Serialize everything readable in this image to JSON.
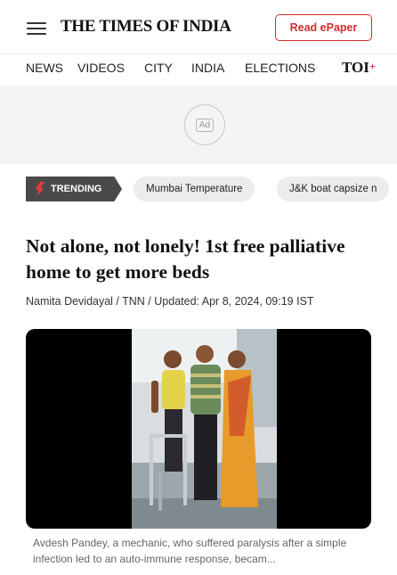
{
  "header": {
    "brand": "THE TIMES OF INDIA",
    "epaper_label": "Read ePaper"
  },
  "nav": {
    "items": [
      "NEWS",
      "VIDEOS",
      "CITY",
      "INDIA",
      "ELECTIONS"
    ],
    "toi_plus": "TOI",
    "toi_plus_mark": "+"
  },
  "ad": {
    "label": "Ad"
  },
  "trending": {
    "tag": "TRENDING",
    "chips": [
      "Mumbai Temperature",
      "J&K boat capsize n"
    ]
  },
  "article": {
    "headline": "Not alone, not lonely! 1st free palliative home to get more beds",
    "byline": "Namita Devidayal / TNN / Updated: Apr 8, 2024, 09:19 IST",
    "caption": "Avdesh Pandey, a mechanic, who suffered paralysis after a simple infection led to an auto-immune response, becam..."
  },
  "colors": {
    "accent": "#d32c2c",
    "trending_bg": "#4a4a4a",
    "chip_bg": "#ececec",
    "ad_bg": "#f4f4f4"
  }
}
